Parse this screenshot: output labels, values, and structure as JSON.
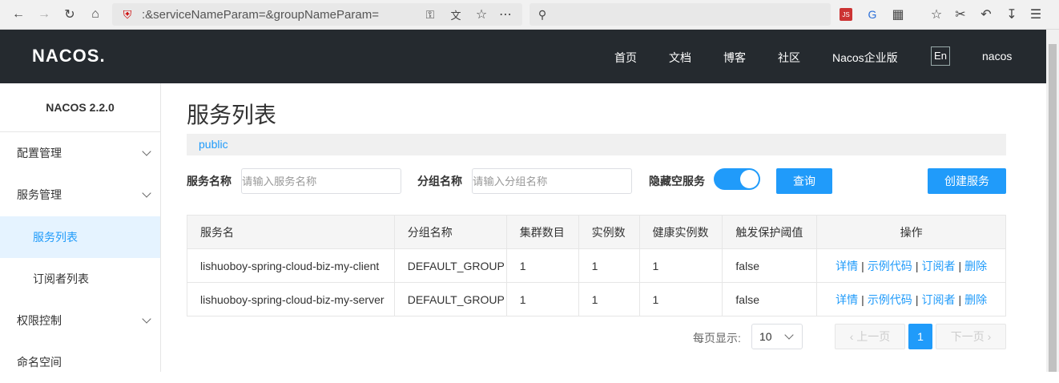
{
  "browser": {
    "url_text": ":&serviceNameParam=&groupNameParam="
  },
  "nav": {
    "logo": "NACOS.",
    "items": [
      "首页",
      "文档",
      "博客",
      "社区",
      "Nacos企业版"
    ],
    "lang": "En",
    "user": "nacos"
  },
  "sidebar": {
    "version": "NACOS 2.2.0",
    "items": [
      {
        "label": "配置管理"
      },
      {
        "label": "服务管理"
      },
      {
        "label": "服务列表"
      },
      {
        "label": "订阅者列表"
      },
      {
        "label": "权限控制"
      },
      {
        "label": "命名空间"
      }
    ]
  },
  "main": {
    "title": "服务列表",
    "namespace": "public",
    "filters": {
      "service_label": "服务名称",
      "service_placeholder": "请输入服务名称",
      "group_label": "分组名称",
      "group_placeholder": "请输入分组名称",
      "hide_empty_label": "隐藏空服务",
      "hide_empty_on": true,
      "query_button": "查询",
      "create_button": "创建服务"
    },
    "table": {
      "headers": [
        "服务名",
        "分组名称",
        "集群数目",
        "实例数",
        "健康实例数",
        "触发保护阈值",
        "操作"
      ],
      "rows": [
        {
          "service": "lishuoboy-spring-cloud-biz-my-client",
          "group": "DEFAULT_GROUP",
          "clusters": "1",
          "instances": "1",
          "healthy": "1",
          "protect": "false"
        },
        {
          "service": "lishuoboy-spring-cloud-biz-my-server",
          "group": "DEFAULT_GROUP",
          "clusters": "1",
          "instances": "1",
          "healthy": "1",
          "protect": "false"
        }
      ],
      "actions": {
        "detail": "详情",
        "sample": "示例代码",
        "subscriber": "订阅者",
        "delete": "删除",
        "sep": "|"
      }
    },
    "pagination": {
      "page_size_label": "每页显示:",
      "page_size": "10",
      "prev": "上一页",
      "current": "1",
      "next": "下一页"
    }
  },
  "colors": {
    "accent": "#209bfa",
    "nav_bg": "#252a2f",
    "active_bg": "#e5f3ff"
  }
}
